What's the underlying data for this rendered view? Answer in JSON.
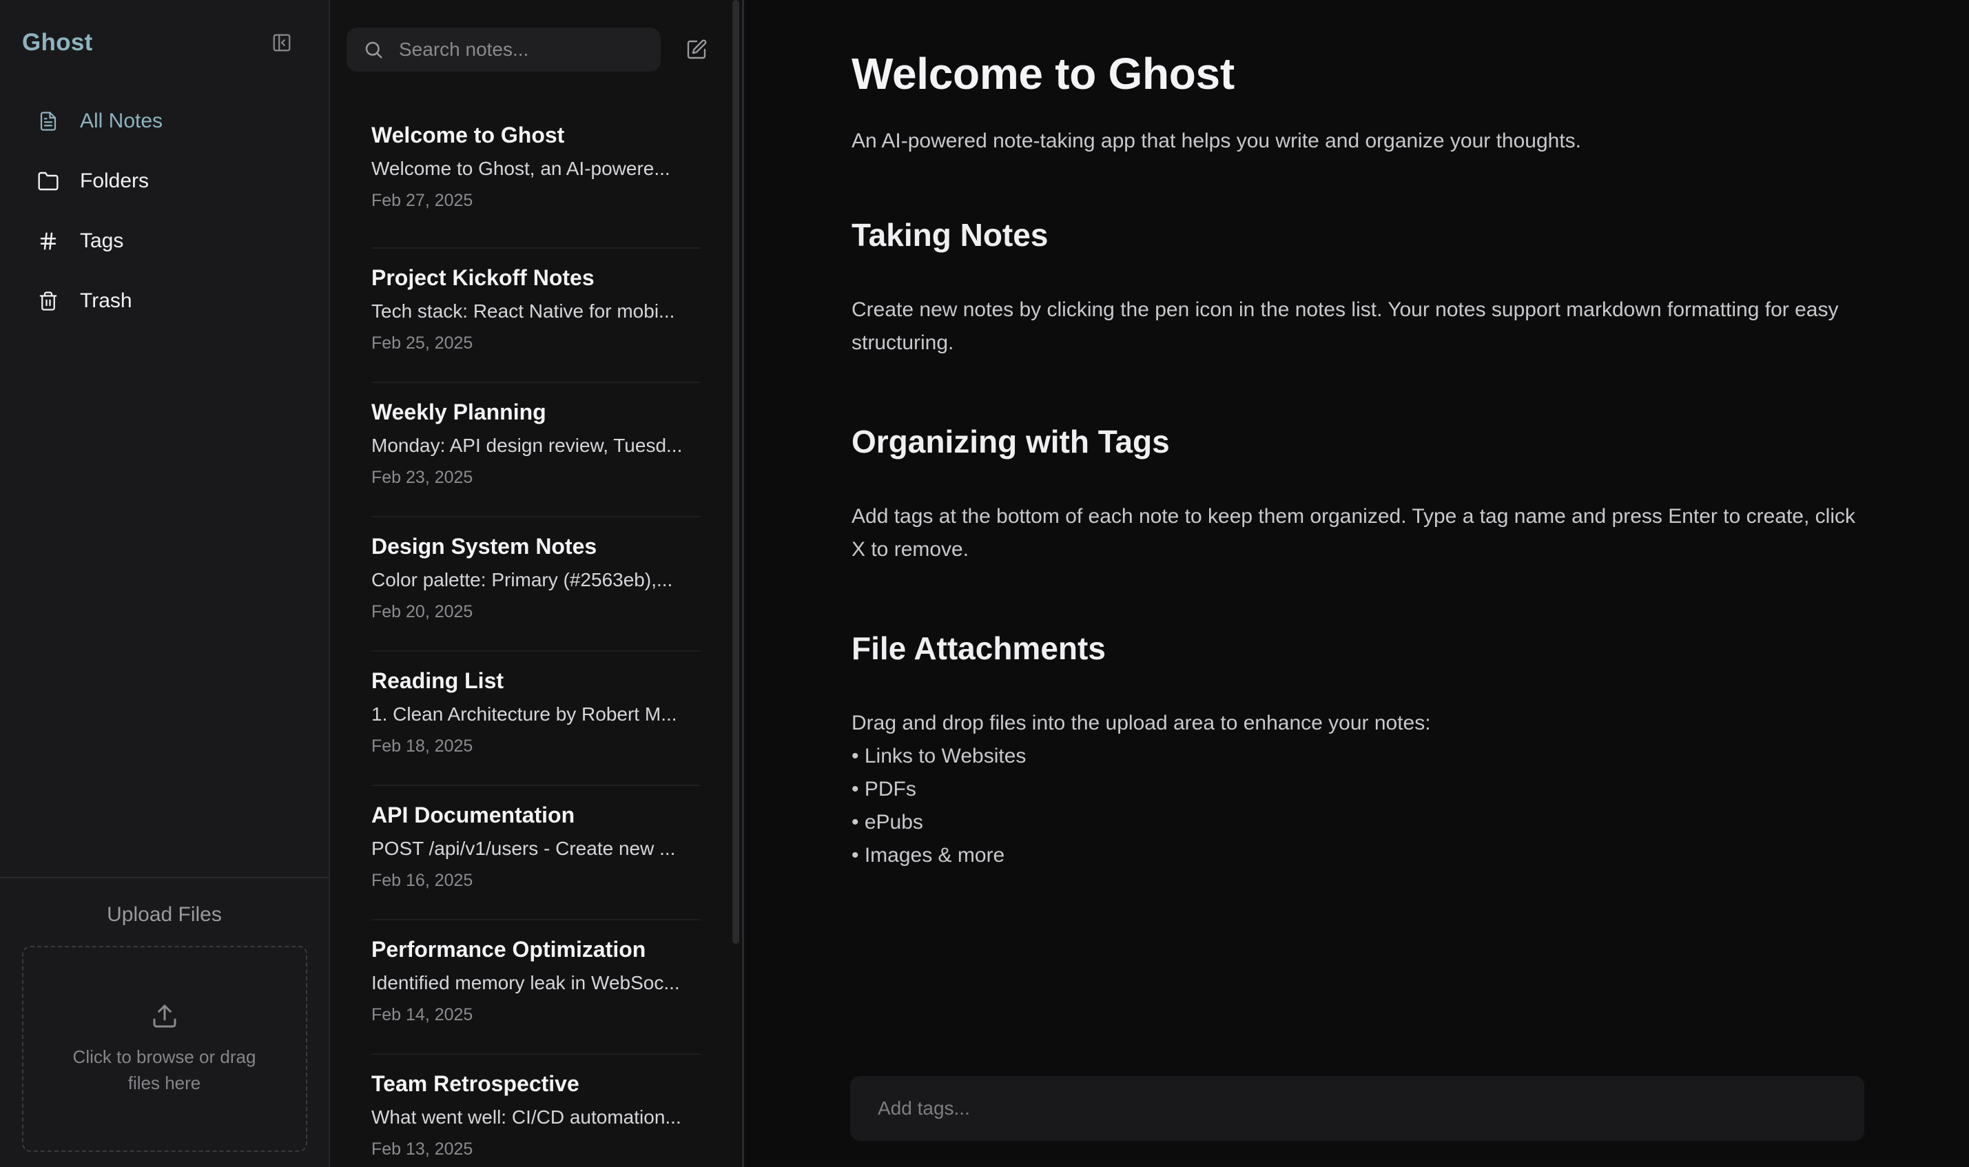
{
  "sidebar": {
    "brand": "Ghost",
    "nav": [
      {
        "label": "All Notes",
        "icon": "file-icon",
        "active": true
      },
      {
        "label": "Folders",
        "icon": "folder-icon",
        "active": false
      },
      {
        "label": "Tags",
        "icon": "hash-icon",
        "active": false
      },
      {
        "label": "Trash",
        "icon": "trash-icon",
        "active": false
      }
    ],
    "upload": {
      "title": "Upload Files",
      "hint": "Click to browse or drag files here"
    }
  },
  "notes": {
    "search_placeholder": "Search notes...",
    "items": [
      {
        "title": "Welcome to Ghost",
        "preview": "Welcome to Ghost, an AI-powere...",
        "date": "Feb 27, 2025"
      },
      {
        "title": "Project Kickoff Notes",
        "preview": "Tech stack: React Native for mobi...",
        "date": "Feb 25, 2025"
      },
      {
        "title": "Weekly Planning",
        "preview": "Monday: API design review, Tuesd...",
        "date": "Feb 23, 2025"
      },
      {
        "title": "Design System Notes",
        "preview": "Color palette: Primary (#2563eb),...",
        "date": "Feb 20, 2025"
      },
      {
        "title": "Reading List",
        "preview": "1. Clean Architecture by Robert M...",
        "date": "Feb 18, 2025"
      },
      {
        "title": "API Documentation",
        "preview": "POST /api/v1/users - Create new ...",
        "date": "Feb 16, 2025"
      },
      {
        "title": "Performance Optimization",
        "preview": "Identified memory leak in WebSoc...",
        "date": "Feb 14, 2025"
      },
      {
        "title": "Team Retrospective",
        "preview": "What went well: CI/CD automation...",
        "date": "Feb 13, 2025"
      }
    ]
  },
  "editor": {
    "title": "Welcome to Ghost",
    "subtitle": "An AI-powered note-taking app that helps you write and organize your thoughts.",
    "sections": [
      {
        "heading": "Taking Notes",
        "body": "Create new notes by clicking the pen icon in the notes list. Your notes support markdown formatting for easy structuring."
      },
      {
        "heading": "Organizing with Tags",
        "body": "Add tags at the bottom of each note to keep them organized. Type a tag name and press Enter to create, click X to remove."
      },
      {
        "heading": "File Attachments",
        "body": "Drag and drop files into the upload area to enhance your notes:",
        "bullets": [
          "• Links to Websites",
          "• PDFs",
          "• ePubs",
          "• Images & more"
        ]
      }
    ],
    "tag_placeholder": "Add tags..."
  },
  "colors": {
    "accent": "#8fb3bf",
    "sidebar_bg": "#19191b",
    "list_bg": "#121213",
    "editor_bg": "#0c0c0d"
  }
}
